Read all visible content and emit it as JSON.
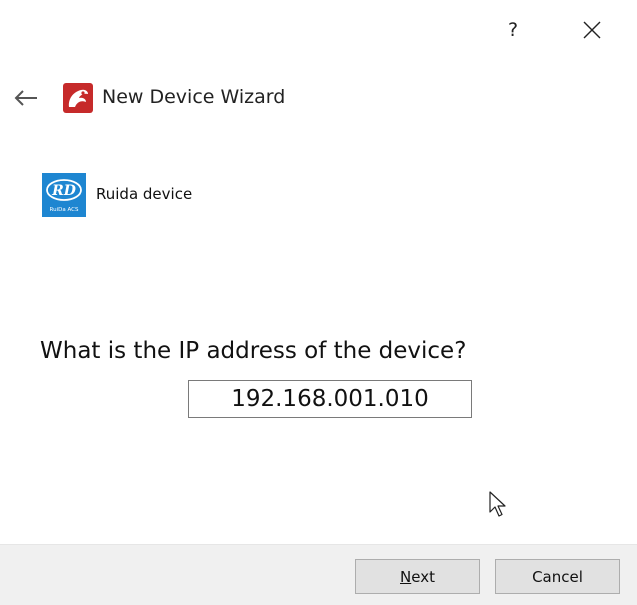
{
  "titlebar": {
    "help_label": "?",
    "close_icon": "close-icon"
  },
  "header": {
    "back_icon": "back-arrow-icon",
    "app_icon": "lightburn-app-icon",
    "title": "New Device Wizard"
  },
  "device": {
    "logo_text": "RD",
    "logo_subtext": "RuiDa ACS",
    "label": "Ruida device"
  },
  "main": {
    "question": "What is the IP address of the device?",
    "ip_value": "192.168.001.010"
  },
  "footer": {
    "next_mnemonic": "N",
    "next_rest": "ext",
    "cancel_label": "Cancel"
  },
  "colors": {
    "footer_bg": "#f0f0f0",
    "button_bg": "#e1e1e1",
    "ruida_blue": "#1e86d1",
    "app_red": "#c62a2a"
  }
}
